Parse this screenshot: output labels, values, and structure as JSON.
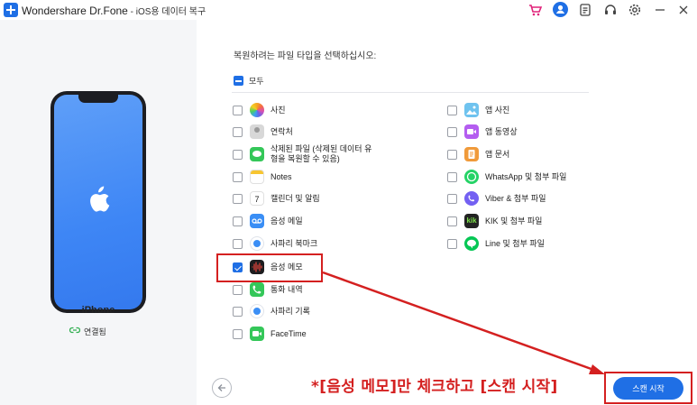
{
  "app": {
    "title": "Wondershare Dr.Fone",
    "subtitle": " - iOS용 데이터 복구"
  },
  "toolbar_icons": [
    "cart-icon",
    "user-icon",
    "document-icon",
    "headset-icon",
    "gear-icon",
    "minimize-icon",
    "close-icon"
  ],
  "device": {
    "name": "iPhone",
    "status": "연결됨"
  },
  "main": {
    "prompt": "복원하려는 파일 타입을 선택하십시오:",
    "select_all_label": "모두",
    "left_items": [
      {
        "label": "사진",
        "icon": "photos-icon",
        "checked": false
      },
      {
        "label": "연락처",
        "icon": "contacts-icon",
        "checked": false
      },
      {
        "label": "삭제된 파일 (삭제된 데이터 유형을 복원할 수 있음)",
        "icon": "messages-icon",
        "checked": false
      },
      {
        "label": "Notes",
        "icon": "notes-icon",
        "checked": false
      },
      {
        "label": "캘린더 및 알림",
        "icon": "calendar-icon",
        "checked": false
      },
      {
        "label": "음성 메일",
        "icon": "voicemail-icon",
        "checked": false
      },
      {
        "label": "사파리 북마크",
        "icon": "safari-icon",
        "checked": false
      },
      {
        "label": "음성 메모",
        "icon": "voice-memo-icon",
        "checked": true
      },
      {
        "label": "통화 내역",
        "icon": "phone-icon",
        "checked": false
      },
      {
        "label": "사파리 기록",
        "icon": "safari-icon",
        "checked": false
      },
      {
        "label": "FaceTime",
        "icon": "facetime-icon",
        "checked": false
      }
    ],
    "right_items": [
      {
        "label": "앱 사진",
        "icon": "app-photo-icon",
        "checked": false
      },
      {
        "label": "앱 동영상",
        "icon": "app-video-icon",
        "checked": false
      },
      {
        "label": "앱 문서",
        "icon": "app-document-icon",
        "checked": false
      },
      {
        "label": "WhatsApp 및 첨부 파일",
        "icon": "whatsapp-icon",
        "checked": false
      },
      {
        "label": "Viber & 첨부 파일",
        "icon": "viber-icon",
        "checked": false
      },
      {
        "label": "KIK 및 첨부 파일",
        "icon": "kik-icon",
        "checked": false
      },
      {
        "label": "Line 및 첨부 파일",
        "icon": "line-icon",
        "checked": false
      }
    ],
    "calendar_day": "7",
    "kik_text": "kik"
  },
  "annotation": {
    "text": "*[음성 메모]만 체크하고 [스캔 시작]",
    "color": "#d42020"
  },
  "footer": {
    "scan_label": "스캔 시작"
  },
  "colors": {
    "accent": "#1f6fe5",
    "annotation_red": "#d42020"
  }
}
